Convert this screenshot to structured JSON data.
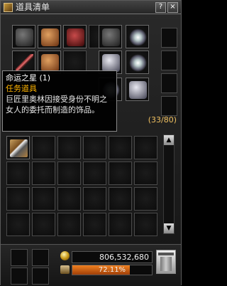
{
  "window": {
    "title": "道具清单",
    "help_label": "?",
    "close_label": "×"
  },
  "tooltip": {
    "name": "命运之星 (1)",
    "type": "任务道具",
    "description": "巨匠里奥林因接受身份不明之女人的委托而制造的饰品。"
  },
  "tab": {
    "count": "(33/80)"
  },
  "scrollbar": {
    "up_icon": "arrow-up-icon",
    "down_icon": "arrow-down-icon"
  },
  "bottom": {
    "gold": "806,532,680",
    "weight": "72.11%",
    "weight_fraction": 0.7211
  },
  "colors": {
    "tooltip_type": "#ffb400",
    "weight_bar": "#f08020"
  }
}
